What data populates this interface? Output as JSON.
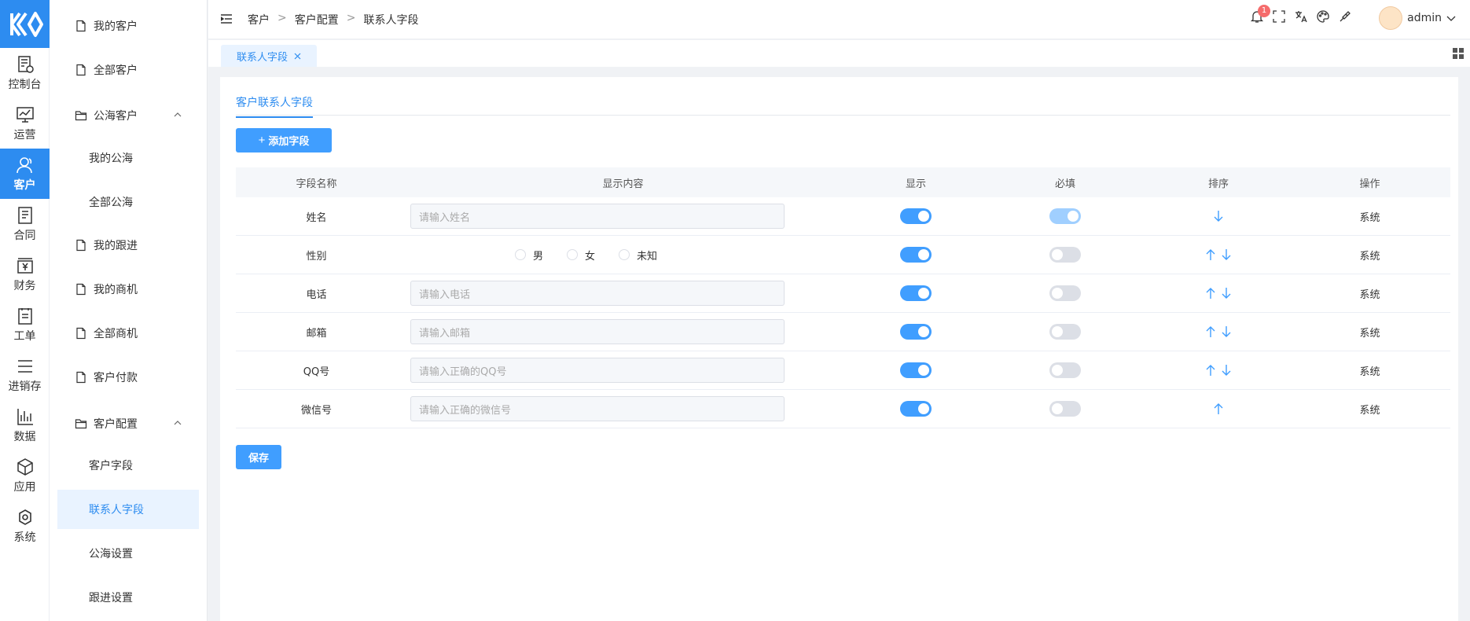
{
  "rail": [
    {
      "label": "控制台",
      "icon": "dashboard-icon"
    },
    {
      "label": "运营",
      "icon": "chart-icon"
    },
    {
      "label": "客户",
      "icon": "user-icon",
      "active": true
    },
    {
      "label": "合同",
      "icon": "contract-icon"
    },
    {
      "label": "财务",
      "icon": "finance-icon"
    },
    {
      "label": "工单",
      "icon": "ticket-icon"
    },
    {
      "label": "进销存",
      "icon": "list-icon"
    },
    {
      "label": "数据",
      "icon": "bar-chart-icon"
    },
    {
      "label": "应用",
      "icon": "cube-icon"
    },
    {
      "label": "系统",
      "icon": "settings-icon"
    }
  ],
  "submenu": {
    "my_customers": "我的客户",
    "all_customers": "全部客户",
    "public_pool": "公海客户",
    "my_pool": "我的公海",
    "all_pool": "全部公海",
    "my_follow": "我的跟进",
    "my_opportunities": "我的商机",
    "all_opportunities": "全部商机",
    "customer_payment": "客户付款",
    "customer_config": "客户配置",
    "customer_fields": "客户字段",
    "contact_fields": "联系人字段",
    "pool_settings": "公海设置",
    "follow_settings": "跟进设置"
  },
  "header": {
    "breadcrumb": [
      "客户",
      "客户配置",
      "联系人字段"
    ],
    "separator": ">",
    "notification_count": "1",
    "username": "admin"
  },
  "tabs": {
    "active": "联系人字段"
  },
  "card": {
    "tab": "客户联系人字段",
    "add_button": "添加字段",
    "save_button": "保存"
  },
  "table": {
    "headers": [
      "字段名称",
      "显示内容",
      "显示",
      "必填",
      "排序",
      "操作"
    ],
    "rows": [
      {
        "name": "姓名",
        "placeholder": "请输入姓名",
        "show": true,
        "required": true,
        "required_disabled": true,
        "up": false,
        "down": true,
        "op": "系统"
      },
      {
        "name": "性别",
        "radios": [
          "男",
          "女",
          "未知"
        ],
        "show": true,
        "required": false,
        "up": true,
        "down": true,
        "op": "系统"
      },
      {
        "name": "电话",
        "placeholder": "请输入电话",
        "show": true,
        "required": false,
        "up": true,
        "down": true,
        "op": "系统"
      },
      {
        "name": "邮箱",
        "placeholder": "请输入邮箱",
        "show": true,
        "required": false,
        "up": true,
        "down": true,
        "op": "系统"
      },
      {
        "name": "QQ号",
        "placeholder": "请输入正确的QQ号",
        "show": true,
        "required": false,
        "up": true,
        "down": true,
        "op": "系统"
      },
      {
        "name": "微信号",
        "placeholder": "请输入正确的微信号",
        "show": true,
        "required": false,
        "up": true,
        "down": false,
        "op": "系统"
      }
    ]
  },
  "colors": {
    "primary": "#2d8cf0",
    "button": "#409eff",
    "active_bg": "#e9f3ff"
  }
}
